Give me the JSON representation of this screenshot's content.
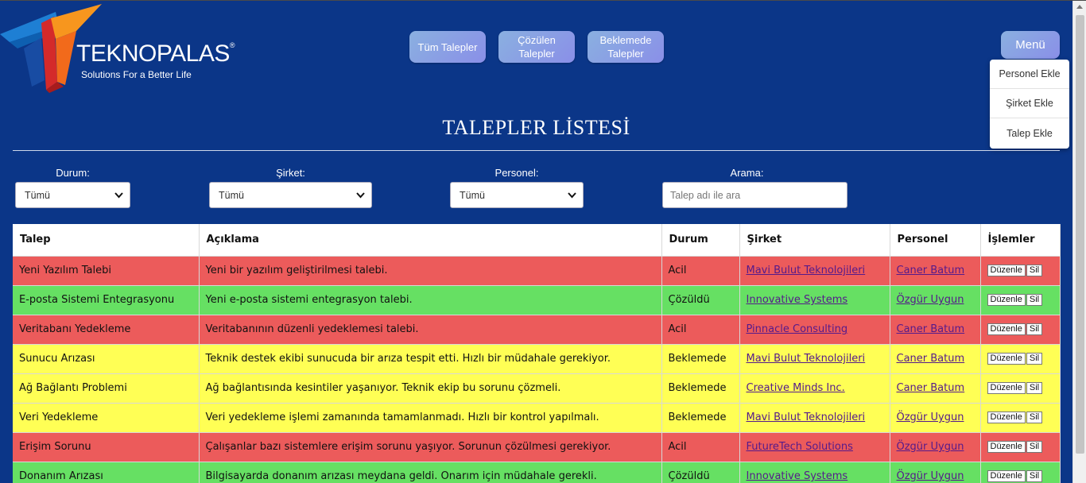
{
  "logo": {
    "brand": "TEKNOPALAS",
    "registered": "®",
    "tagline": "Solutions For a Better Life"
  },
  "nav": {
    "all_requests": "Tüm Talepler",
    "solved_requests": "Çözülen Talepler",
    "pending_requests": "Beklemede Talepler",
    "menu": "Menü"
  },
  "menu_items": [
    "Personel Ekle",
    "Şirket Ekle",
    "Talep Ekle"
  ],
  "page_title": "TALEPLER LİSTESİ",
  "filters": {
    "status_label": "Durum:",
    "status_value": "Tümü",
    "company_label": "Şirket:",
    "company_value": "Tümü",
    "staff_label": "Personel:",
    "staff_value": "Tümü",
    "search_label": "Arama:",
    "search_placeholder": "Talep adı ile ara"
  },
  "table": {
    "headers": [
      "Talep",
      "Açıklama",
      "Durum",
      "Şirket",
      "Personel",
      "İşlemler"
    ],
    "edit_label": "Düzenle",
    "delete_label": "Sil",
    "rows": [
      {
        "talep": "Yeni Yazılım Talebi",
        "aciklama": "Yeni bir yazılım geliştirilmesi talebi.",
        "durum": "Acil",
        "sirket": "Mavi Bulut Teknolojileri",
        "personel": "Caner Batum"
      },
      {
        "talep": "E-posta Sistemi Entegrasyonu",
        "aciklama": "Yeni e-posta sistemi entegrasyon talebi.",
        "durum": "Çözüldü",
        "sirket": "Innovative Systems",
        "personel": "Özgür Uygun"
      },
      {
        "talep": "Veritabanı Yedekleme",
        "aciklama": "Veritabanının düzenli yedeklemesi talebi.",
        "durum": "Acil",
        "sirket": "Pinnacle Consulting",
        "personel": "Caner Batum"
      },
      {
        "talep": "Sunucu Arızası",
        "aciklama": "Teknik destek ekibi sunucuda bir arıza tespit etti. Hızlı bir müdahale gerekiyor.",
        "durum": "Beklemede",
        "sirket": "Mavi Bulut Teknolojileri",
        "personel": "Caner Batum"
      },
      {
        "talep": "Ağ Bağlantı Problemi",
        "aciklama": "Ağ bağlantısında kesintiler yaşanıyor. Teknik ekip bu sorunu çözmeli.",
        "durum": "Beklemede",
        "sirket": "Creative Minds Inc.",
        "personel": "Caner Batum"
      },
      {
        "talep": "Veri Yedekleme",
        "aciklama": "Veri yedekleme işlemi zamanında tamamlanmadı. Hızlı bir kontrol yapılmalı.",
        "durum": "Beklemede",
        "sirket": "Mavi Bulut Teknolojileri",
        "personel": "Özgür Uygun"
      },
      {
        "talep": "Erişim Sorunu",
        "aciklama": "Çalışanlar bazı sistemlere erişim sorunu yaşıyor. Sorunun çözülmesi gerekiyor.",
        "durum": "Acil",
        "sirket": "FutureTech Solutions",
        "personel": "Özgür Uygun"
      },
      {
        "talep": "Donanım Arızası",
        "aciklama": "Bilgisayarda donanım arızası meydana geldi. Onarım için müdahale gerekli.",
        "durum": "Çözüldü",
        "sirket": "Innovative Systems",
        "personel": "Özgür Uygun"
      }
    ]
  },
  "colors": {
    "background": "#0b3688",
    "acil": "#ec5b5b",
    "cozuldu": "#66e063",
    "beklemede": "#ffff55",
    "link": "#551a8b"
  }
}
